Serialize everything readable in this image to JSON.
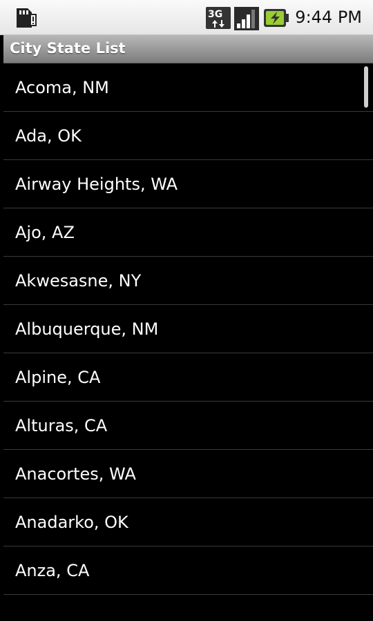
{
  "status_bar": {
    "time": "9:44 PM",
    "icons": [
      "sd-card-icon",
      "3g-network-icon",
      "signal-strength-icon",
      "battery-charging-icon"
    ],
    "network_label": "3G"
  },
  "app": {
    "title": "City State List"
  },
  "list": {
    "items": [
      "Acoma, NM",
      "Ada, OK",
      "Airway Heights, WA",
      "Ajo, AZ",
      "Akwesasne, NY",
      "Albuquerque, NM",
      "Alpine, CA",
      "Alturas, CA",
      "Anacortes, WA",
      "Anadarko, OK",
      "Anza, CA"
    ]
  },
  "colors": {
    "background": "#000000",
    "title_bar": "#9a9a9a",
    "status_bar": "#eeeeee",
    "list_text": "#ffffff",
    "divider": "#3a3a3a"
  }
}
